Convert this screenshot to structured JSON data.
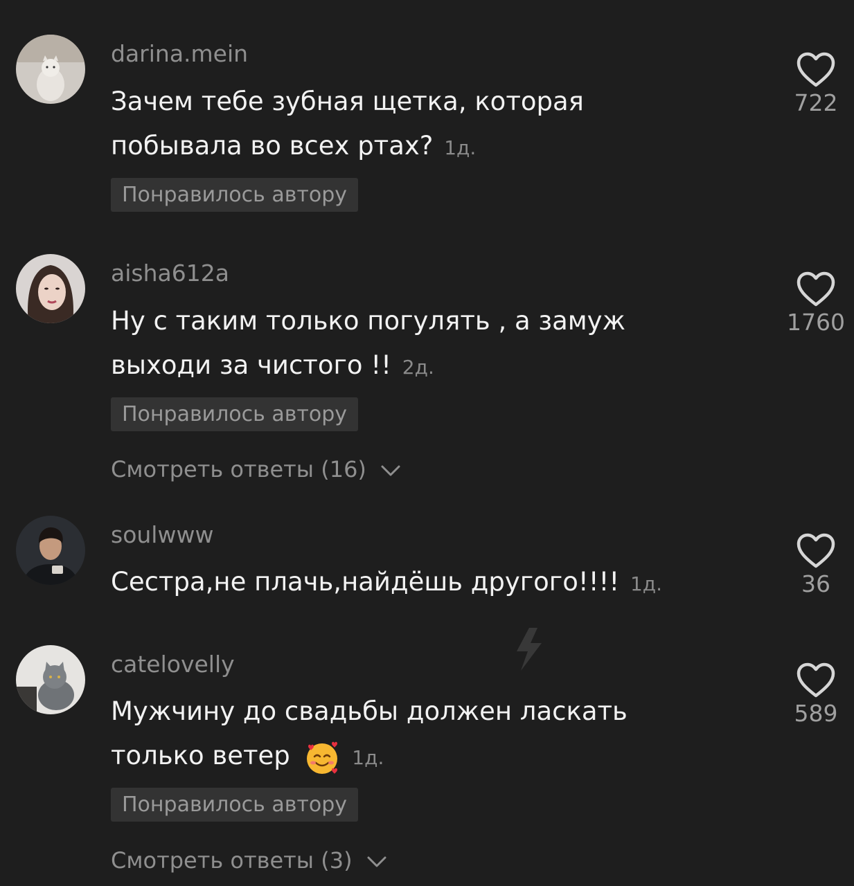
{
  "comments": [
    {
      "username": "darina.mein",
      "text": "Зачем тебе зубная щетка, которая побывала во всех ртах?",
      "time": "1д.",
      "badge": "Понравилось автору",
      "likes": "722",
      "avatar_icon": "cat-avatar"
    },
    {
      "username": "aisha612a",
      "text": "Ну с таким только погулять , а замуж выходи за чистого !!",
      "time": "2д.",
      "badge": "Понравилось автору",
      "replies": "Смотреть ответы (16)",
      "likes": "1760",
      "avatar_icon": "woman-avatar"
    },
    {
      "username": "soulwww",
      "text": "Сестра,не плачь,найдёшь другого!!!!",
      "time": "1д.",
      "likes": "36",
      "avatar_icon": "man-avatar"
    },
    {
      "username": "catelovelly",
      "text": "Мужчину до свадьбы должен ласкать только ветер",
      "emoji": "smiling-face-with-hearts",
      "time": "1д.",
      "badge": "Понравилось автору",
      "replies": "Смотреть ответы (3)",
      "likes": "589",
      "avatar_icon": "grey-cat-avatar"
    }
  ],
  "colors": {
    "background": "#1e1e1e",
    "username": "#8f8f8f",
    "text": "#f2f2f2",
    "badge_bg": "#333333",
    "badge_text": "#9a9a9a"
  }
}
